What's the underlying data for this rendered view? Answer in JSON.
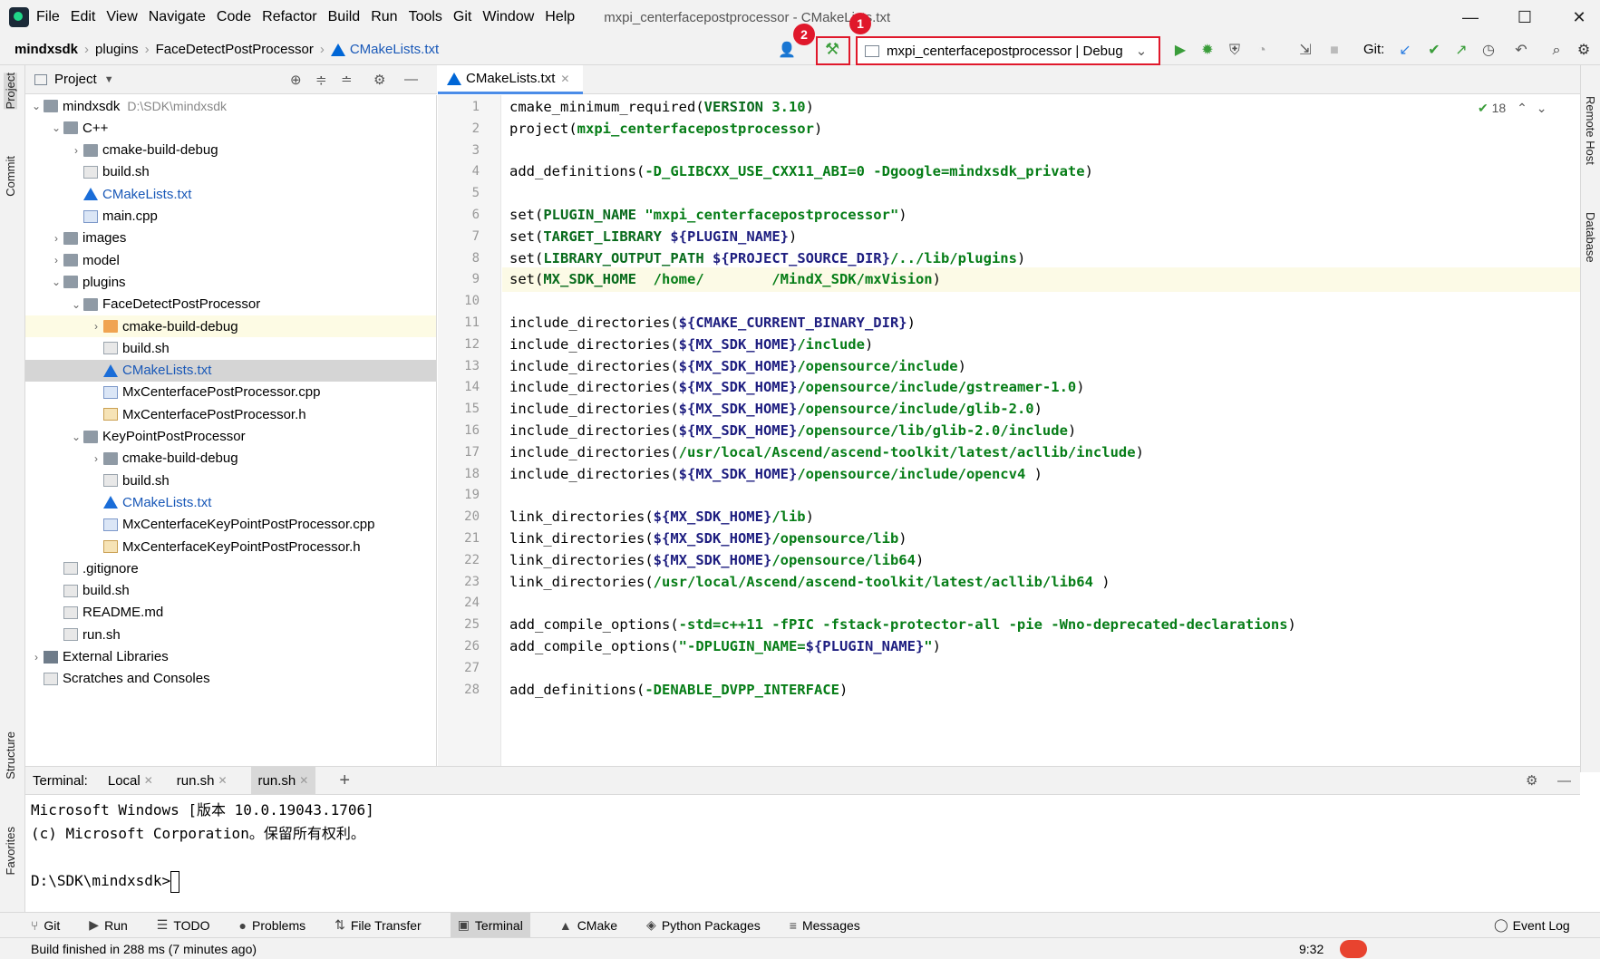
{
  "menubar": {
    "items": [
      "File",
      "Edit",
      "View",
      "Navigate",
      "Code",
      "Refactor",
      "Build",
      "Run",
      "Tools",
      "Git",
      "Window",
      "Help"
    ],
    "window_title": "mxpi_centerfacepostprocessor - CMakeLists.txt"
  },
  "navbar": {
    "breadcrumb": [
      "mindxsdk",
      "plugins",
      "FaceDetectPostProcessor",
      "CMakeLists.txt"
    ],
    "run_config": "mxpi_centerfacepostprocessor | Debug",
    "badge1": "1",
    "badge2": "2",
    "git_label": "Git:"
  },
  "left_strip": {
    "project": "Project",
    "commit": "Commit",
    "structure": "Structure",
    "favorites": "Favorites"
  },
  "right_strip": {
    "remote": "Remote Host",
    "database": "Database"
  },
  "project_panel": {
    "title": "Project",
    "tree": [
      {
        "label": "mindxsdk",
        "path": "D:\\SDK\\mindxsdk",
        "depth": 0,
        "icon": "folder",
        "expanded": true
      },
      {
        "label": "C++",
        "depth": 1,
        "icon": "folder",
        "expanded": true
      },
      {
        "label": "cmake-build-debug",
        "depth": 2,
        "icon": "folder",
        "expanded": false
      },
      {
        "label": "build.sh",
        "depth": 2,
        "icon": "file"
      },
      {
        "label": "CMakeLists.txt",
        "depth": 2,
        "icon": "cmake",
        "blue": true
      },
      {
        "label": "main.cpp",
        "depth": 2,
        "icon": "cpp"
      },
      {
        "label": "images",
        "depth": 1,
        "icon": "folder",
        "expanded": false
      },
      {
        "label": "model",
        "depth": 1,
        "icon": "folder",
        "expanded": false
      },
      {
        "label": "plugins",
        "depth": 1,
        "icon": "folder",
        "expanded": true
      },
      {
        "label": "FaceDetectPostProcessor",
        "depth": 2,
        "icon": "folder",
        "expanded": true
      },
      {
        "label": "cmake-build-debug",
        "depth": 3,
        "icon": "folder-orange",
        "expanded": false,
        "hl": true
      },
      {
        "label": "build.sh",
        "depth": 3,
        "icon": "file"
      },
      {
        "label": "CMakeLists.txt",
        "depth": 3,
        "icon": "cmake",
        "blue": true,
        "sel": true
      },
      {
        "label": "MxCenterfacePostProcessor.cpp",
        "depth": 3,
        "icon": "cpp"
      },
      {
        "label": "MxCenterfacePostProcessor.h",
        "depth": 3,
        "icon": "h"
      },
      {
        "label": "KeyPointPostProcessor",
        "depth": 2,
        "icon": "folder",
        "expanded": true
      },
      {
        "label": "cmake-build-debug",
        "depth": 3,
        "icon": "folder",
        "expanded": false
      },
      {
        "label": "build.sh",
        "depth": 3,
        "icon": "file"
      },
      {
        "label": "CMakeLists.txt",
        "depth": 3,
        "icon": "cmake",
        "blue": true
      },
      {
        "label": "MxCenterfaceKeyPointPostProcessor.cpp",
        "depth": 3,
        "icon": "cpp"
      },
      {
        "label": "MxCenterfaceKeyPointPostProcessor.h",
        "depth": 3,
        "icon": "h"
      },
      {
        "label": ".gitignore",
        "depth": 1,
        "icon": "file"
      },
      {
        "label": "build.sh",
        "depth": 1,
        "icon": "file"
      },
      {
        "label": "README.md",
        "depth": 1,
        "icon": "file"
      },
      {
        "label": "run.sh",
        "depth": 1,
        "icon": "file"
      },
      {
        "label": "External Libraries",
        "depth": 0,
        "icon": "lib",
        "expanded": false
      },
      {
        "label": "Scratches and Consoles",
        "depth": 0,
        "icon": "file"
      }
    ]
  },
  "editor": {
    "tab": "CMakeLists.txt",
    "inspection_count": "18",
    "lines": [
      "cmake_minimum_required(VERSION 3.10)",
      "project(mxpi_centerfacepostprocessor)",
      "",
      "add_definitions(-D_GLIBCXX_USE_CXX11_ABI=0 -Dgoogle=mindxsdk_private)",
      "",
      "set(PLUGIN_NAME \"mxpi_centerfacepostprocessor\")",
      "set(TARGET_LIBRARY ${PLUGIN_NAME})",
      "set(LIBRARY_OUTPUT_PATH ${PROJECT_SOURCE_DIR}/../lib/plugins)",
      "set(MX_SDK_HOME  /home/        /MindX_SDK/mxVision)",
      "",
      "include_directories(${CMAKE_CURRENT_BINARY_DIR})",
      "include_directories(${MX_SDK_HOME}/include)",
      "include_directories(${MX_SDK_HOME}/opensource/include)",
      "include_directories(${MX_SDK_HOME}/opensource/include/gstreamer-1.0)",
      "include_directories(${MX_SDK_HOME}/opensource/include/glib-2.0)",
      "include_directories(${MX_SDK_HOME}/opensource/lib/glib-2.0/include)",
      "include_directories(/usr/local/Ascend/ascend-toolkit/latest/acllib/include)",
      "include_directories(${MX_SDK_HOME}/opensource/include/opencv4 )",
      "",
      "link_directories(${MX_SDK_HOME}/lib)",
      "link_directories(${MX_SDK_HOME}/opensource/lib)",
      "link_directories(${MX_SDK_HOME}/opensource/lib64)",
      "link_directories(/usr/local/Ascend/ascend-toolkit/latest/acllib/lib64 )",
      "",
      "add_compile_options(-std=c++11 -fPIC -fstack-protector-all -pie -Wno-deprecated-declarations)",
      "add_compile_options(\"-DPLUGIN_NAME=${PLUGIN_NAME}\")",
      "",
      "add_definitions(-DENABLE_DVPP_INTERFACE)"
    ],
    "line_numbers": [
      "1",
      "2",
      "3",
      "4",
      "5",
      "6",
      "7",
      "8",
      "9",
      "10",
      "11",
      "12",
      "13",
      "14",
      "15",
      "16",
      "17",
      "18",
      "19",
      "20",
      "21",
      "22",
      "23",
      "24",
      "25",
      "26",
      "27",
      "28"
    ]
  },
  "terminal": {
    "label": "Terminal:",
    "tabs": [
      "Local",
      "run.sh",
      "run.sh"
    ],
    "lines": [
      "Microsoft Windows [版本 10.0.19043.1706]",
      "(c) Microsoft Corporation。保留所有权利。",
      "",
      "D:\\SDK\\mindxsdk>"
    ]
  },
  "tool_windows": [
    "Git",
    "Run",
    "TODO",
    "Problems",
    "File Transfer",
    "Terminal",
    "CMake",
    "Python Packages",
    "Messages"
  ],
  "event_log": "Event Log",
  "status": {
    "message": "Build finished in 288 ms (7 minutes ago)",
    "time": "9:32"
  }
}
